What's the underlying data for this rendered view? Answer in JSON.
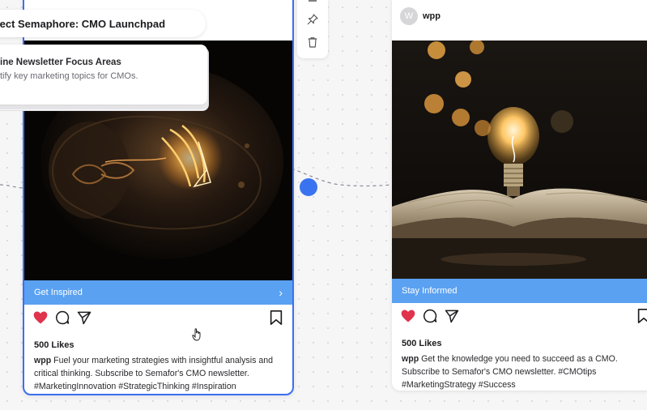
{
  "colors": {
    "accent": "#3b6ff0",
    "cta": "#5aa1f1",
    "heart": "#e0334c",
    "node": "#3a73ef"
  },
  "left_card": {
    "title": "ject Semaphore: CMO Launchpad",
    "note": {
      "title": "ine Newsletter Focus Areas",
      "subtitle": "tify key marketing topics for CMOs."
    },
    "cta_label": "Get Inspired",
    "cta_icon": "chevron-right-icon",
    "likes": "500 Likes",
    "author": "wpp",
    "caption": "Fuel your marketing strategies with insightful analysis and critical thinking. Subscribe to Semafor's CMO newsletter. #MarketingInnovation #StrategicThinking #Inspiration"
  },
  "right_card": {
    "avatar_letter": "W",
    "author_header": "wpp",
    "cta_label": "Stay Informed",
    "likes": "500 Likes",
    "author": "wpp",
    "caption": "Get the knowledge you need to succeed as a CMO. Subscribe to Semafor's CMO newsletter. #CMOtips #MarketingStrategy #Success"
  },
  "toolbar": {
    "icons": [
      "pin-icon",
      "trash-icon"
    ]
  },
  "action_icons": [
    "heart-icon",
    "comment-icon",
    "share-icon",
    "bookmark-icon"
  ]
}
